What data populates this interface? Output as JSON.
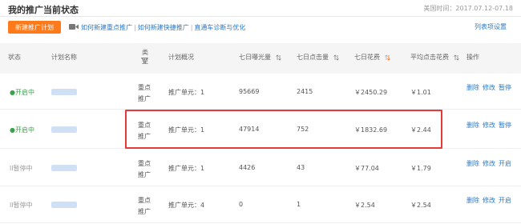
{
  "page": {
    "title": "我的推广当前状态",
    "date_range": "美国时间：2017.07.12-07.18"
  },
  "toolbar": {
    "create_label": "新建推广计划",
    "links": [
      "如何新建重点推广",
      "如何新建快捷推广",
      "直通车诊断与优化"
    ],
    "separator": "|",
    "column_settings": "列表项设置"
  },
  "table": {
    "headers": {
      "status": "状态",
      "name": "计划名称",
      "type": "类型",
      "overview": "计划概况",
      "impressions": "七日曝光量",
      "clicks": "七日点击量",
      "spend": "七日花费",
      "avg_cpc": "平均点击花费",
      "actions": "操作"
    },
    "rows": [
      {
        "status": "开启中",
        "status_dot": "●",
        "type": "重点推广",
        "overview": "推广单元：1",
        "impressions": "95669",
        "clicks": "2415",
        "spend": "￥2450.29",
        "avg_cpc": "￥1.01",
        "actions": [
          "删除",
          "修改",
          "暂停"
        ]
      },
      {
        "status": "开启中",
        "status_dot": "●",
        "type": "重点推广",
        "overview": "推广单元：1",
        "impressions": "47914",
        "clicks": "752",
        "spend": "￥1832.69",
        "avg_cpc": "￥2.44",
        "actions": [
          "删除",
          "修改",
          "暂停"
        ]
      },
      {
        "status": "暂停中",
        "status_dot": "ll",
        "type": "重点推广",
        "overview": "推广单元：1",
        "impressions": "4426",
        "clicks": "43",
        "spend": "￥77.04",
        "avg_cpc": "￥1.79",
        "actions": [
          "删除",
          "修改",
          "开启"
        ]
      },
      {
        "status": "暂停中",
        "status_dot": "ll",
        "type": "重点推广",
        "overview": "推广单元：4",
        "impressions": "0",
        "clicks": "1",
        "spend": "￥2.54",
        "avg_cpc": "￥2.54",
        "actions": [
          "删除",
          "修改",
          "开启"
        ]
      }
    ]
  },
  "colors": {
    "accent": "#ff7a1a",
    "link": "#2a7ac8",
    "status_on": "#3ba34b",
    "highlight": "#e63a3a"
  }
}
